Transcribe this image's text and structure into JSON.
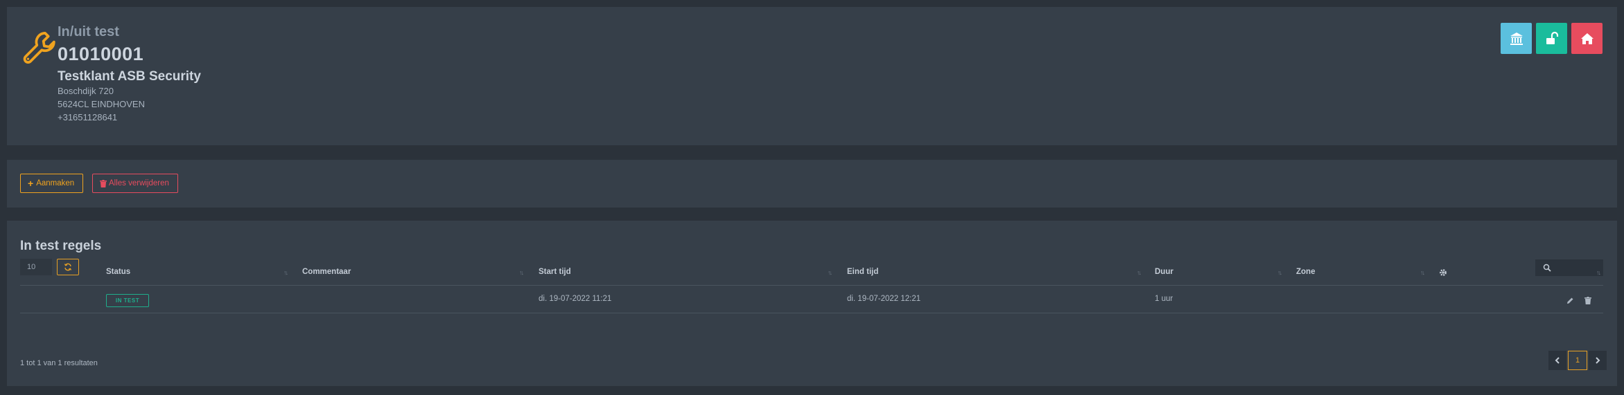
{
  "header": {
    "title": "In/uit test",
    "code": "01010001",
    "customer": "Testklant ASB Security",
    "address_line1": "Boschdijk 720",
    "address_line2": "5624CL EINDHOVEN",
    "phone": "+31651128641",
    "icon": "wrench-icon",
    "buttons": [
      {
        "icon": "bank-icon",
        "color": "#5bc0de"
      },
      {
        "icon": "unlock-icon",
        "color": "#1abc9c"
      },
      {
        "icon": "home-icon",
        "color": "#e74c5e"
      }
    ]
  },
  "actions": {
    "create_label": "Aanmaken",
    "delete_all_label": "Alles verwijderen",
    "create_color": "#f0a31f",
    "delete_color": "#e74c5e"
  },
  "table": {
    "title": "In test regels",
    "page_size": "10",
    "search_placeholder": "",
    "columns": [
      "Status",
      "Commentaar",
      "Start tijd",
      "Eind tijd",
      "Duur",
      "Zone"
    ],
    "rows": [
      {
        "status": "IN TEST",
        "commentaar": "",
        "start": "di. 19-07-2022 11:21",
        "eind": "di. 19-07-2022 12:21",
        "duur": "1 uur",
        "zone": ""
      }
    ],
    "footer": "1 tot 1 van 1 resultaten",
    "current_page": "1"
  }
}
